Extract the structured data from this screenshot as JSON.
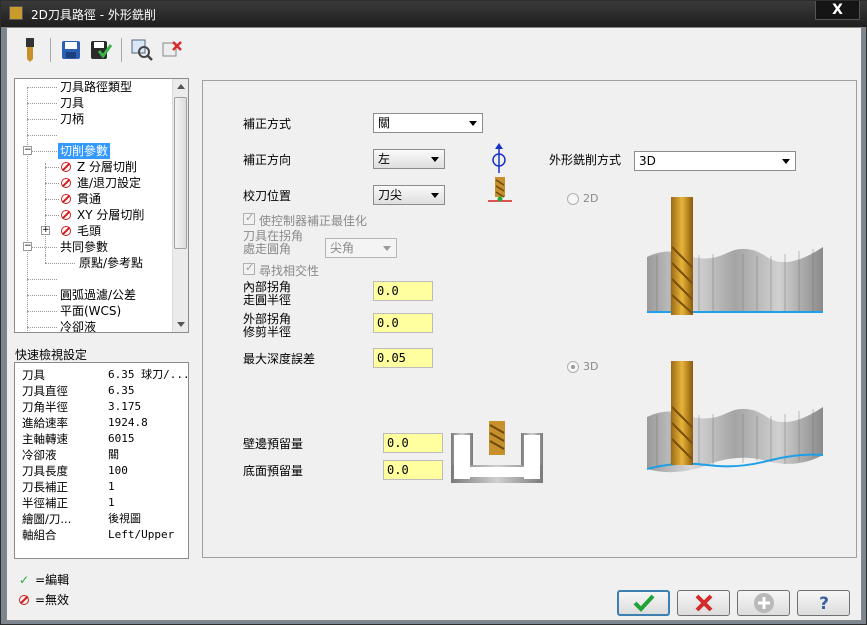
{
  "window": {
    "title": "2D刀具路徑 - 外形銑削",
    "close_label": "X"
  },
  "toolbar": {
    "icons": [
      "tool-icon",
      "save-icon",
      "save-green-icon",
      "view-icon",
      "delete-icon"
    ]
  },
  "tree": {
    "items": [
      {
        "label": "刀具路徑類型",
        "invalid": false
      },
      {
        "label": "刀具",
        "invalid": false
      },
      {
        "label": "刀柄",
        "invalid": false
      },
      {
        "label": "",
        "invalid": false
      },
      {
        "label": "切削參數",
        "invalid": false,
        "selected": true
      },
      {
        "label": "Z 分層切削",
        "invalid": true
      },
      {
        "label": "進/退刀設定",
        "invalid": true
      },
      {
        "label": "貫通",
        "invalid": true
      },
      {
        "label": "XY 分層切削",
        "invalid": true
      },
      {
        "label": "毛頭",
        "invalid": true
      },
      {
        "label": "共同參數",
        "invalid": false
      },
      {
        "label": "原點/參考點",
        "invalid": false
      },
      {
        "label": "",
        "invalid": false
      },
      {
        "label": "圓弧過濾/公差",
        "invalid": false
      },
      {
        "label": "平面(WCS)",
        "invalid": false
      },
      {
        "label": "冷卻液",
        "invalid": false
      }
    ]
  },
  "quickview": {
    "title": "快速檢視設定",
    "rows": [
      {
        "key": "刀具",
        "value": "6.35 球刀/..."
      },
      {
        "key": "刀具直徑",
        "value": "6.35"
      },
      {
        "key": "刀角半徑",
        "value": "3.175"
      },
      {
        "key": "進給速率",
        "value": "1924.8"
      },
      {
        "key": "主軸轉速",
        "value": "6015"
      },
      {
        "key": "冷卻液",
        "value": "關"
      },
      {
        "key": "刀具長度",
        "value": "100"
      },
      {
        "key": "刀長補正",
        "value": "1"
      },
      {
        "key": "半徑補正",
        "value": "1"
      },
      {
        "key": "繪圖/刀...",
        "value": "後視圖"
      },
      {
        "key": "軸組合",
        "value": "Left/Upper"
      }
    ]
  },
  "legend": {
    "edited": "=編輯",
    "invalid": "=無效"
  },
  "form": {
    "comp_type_label": "補正方式",
    "comp_type_value": "關",
    "comp_dir_label": "補正方向",
    "comp_dir_value": "左",
    "tip_comp_label": "校刀位置",
    "tip_comp_value": "刀尖",
    "optimize_label": "使控制器補正最佳化",
    "roll_corners_label_1": "刀具在拐角",
    "roll_corners_label_2": "處走圓角",
    "roll_corners_value": "尖角",
    "infinite_look_label": "尋找相交性",
    "inner_corner_label_1": "內部拐角",
    "inner_corner_label_2": "走圓半徑",
    "inner_corner_value": "0.0",
    "outer_corner_label_1": "外部拐角",
    "outer_corner_label_2": "修剪半徑",
    "outer_corner_value": "0.0",
    "max_depth_label": "最大深度誤差",
    "max_depth_value": "0.05",
    "wall_stock_label": "壁邊預留量",
    "wall_stock_value": "0.0",
    "floor_stock_label": "底面預留量",
    "floor_stock_value": "0.0",
    "contour_type_label": "外形銑削方式",
    "contour_type_value": "3D",
    "radio_2d_label": "2D",
    "radio_3d_label": "3D"
  },
  "buttons": {
    "ok": "check-icon",
    "cancel": "x-icon",
    "add": "plus-icon",
    "help": "help-icon"
  }
}
